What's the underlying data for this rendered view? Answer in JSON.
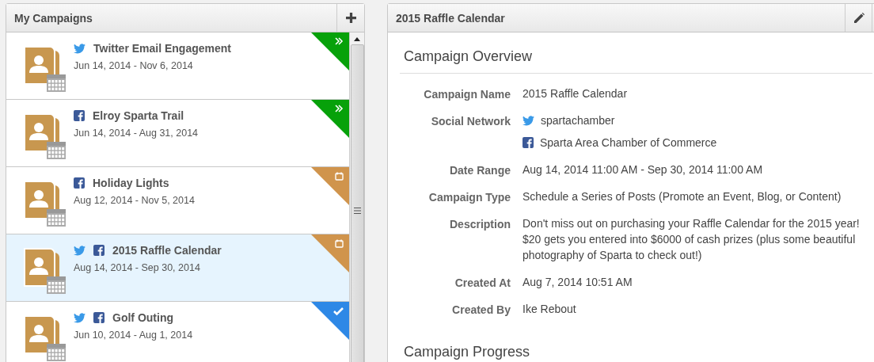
{
  "campaigns_panel": {
    "title": "My Campaigns"
  },
  "campaigns": [
    {
      "title": "Twitter Email Engagement",
      "dates": "Jun 14, 2014 - Nov 6, 2014",
      "networks": [
        {
          "kind": "twitter"
        }
      ],
      "status": {
        "kind": "active"
      },
      "selected": false
    },
    {
      "title": "Elroy Sparta Trail",
      "dates": "Jun 14, 2014 - Aug 31, 2014",
      "networks": [
        {
          "kind": "facebook"
        }
      ],
      "status": {
        "kind": "active"
      },
      "selected": false
    },
    {
      "title": "Holiday Lights",
      "dates": "Aug 12, 2014 - Nov 5, 2014",
      "networks": [
        {
          "kind": "facebook"
        }
      ],
      "status": {
        "kind": "scheduled"
      },
      "selected": false
    },
    {
      "title": "2015 Raffle Calendar",
      "dates": "Aug 14, 2014 - Sep 30, 2014",
      "networks": [
        {
          "kind": "twitter"
        },
        {
          "kind": "facebook"
        }
      ],
      "status": {
        "kind": "scheduled"
      },
      "selected": true
    },
    {
      "title": "Golf Outing",
      "dates": "Jun 10, 2014 - Aug 1, 2014",
      "networks": [
        {
          "kind": "twitter"
        },
        {
          "kind": "facebook"
        }
      ],
      "status": {
        "kind": "completed"
      },
      "selected": false
    }
  ],
  "detail_panel": {
    "title": "2015 Raffle Calendar"
  },
  "overview": {
    "heading": "Campaign Overview",
    "fields": [
      {
        "label": "Campaign Name",
        "values": [
          {
            "text": "2015 Raffle Calendar",
            "kind": "plain"
          }
        ]
      },
      {
        "label": "Social Network",
        "values": [
          {
            "text": "spartachamber",
            "kind": "twitter"
          },
          {
            "text": "Sparta Area Chamber of Commerce",
            "kind": "facebook"
          }
        ]
      },
      {
        "label": "Date Range",
        "values": [
          {
            "text": "Aug 14, 2014 11:00 AM - Sep 30, 2014 11:00 AM",
            "kind": "plain"
          }
        ]
      },
      {
        "label": "Campaign Type",
        "values": [
          {
            "text": "Schedule a Series of Posts (Promote an Event, Blog, or Content)",
            "kind": "plain"
          }
        ]
      },
      {
        "label": "Description",
        "values": [
          {
            "text": "Don't miss out on purchasing your Raffle Calendar for the 2015 year! $20 gets you entered into $6000 of cash prizes (plus some beautiful photography of Sparta to check out!)",
            "kind": "plain"
          }
        ]
      },
      {
        "label": "Created At",
        "values": [
          {
            "text": "Aug 7, 2014 10:51 AM",
            "kind": "plain"
          }
        ]
      },
      {
        "label": "Created By",
        "values": [
          {
            "text": "Ike Rebout",
            "kind": "plain"
          }
        ]
      }
    ]
  },
  "progress": {
    "heading": "Campaign Progress"
  }
}
